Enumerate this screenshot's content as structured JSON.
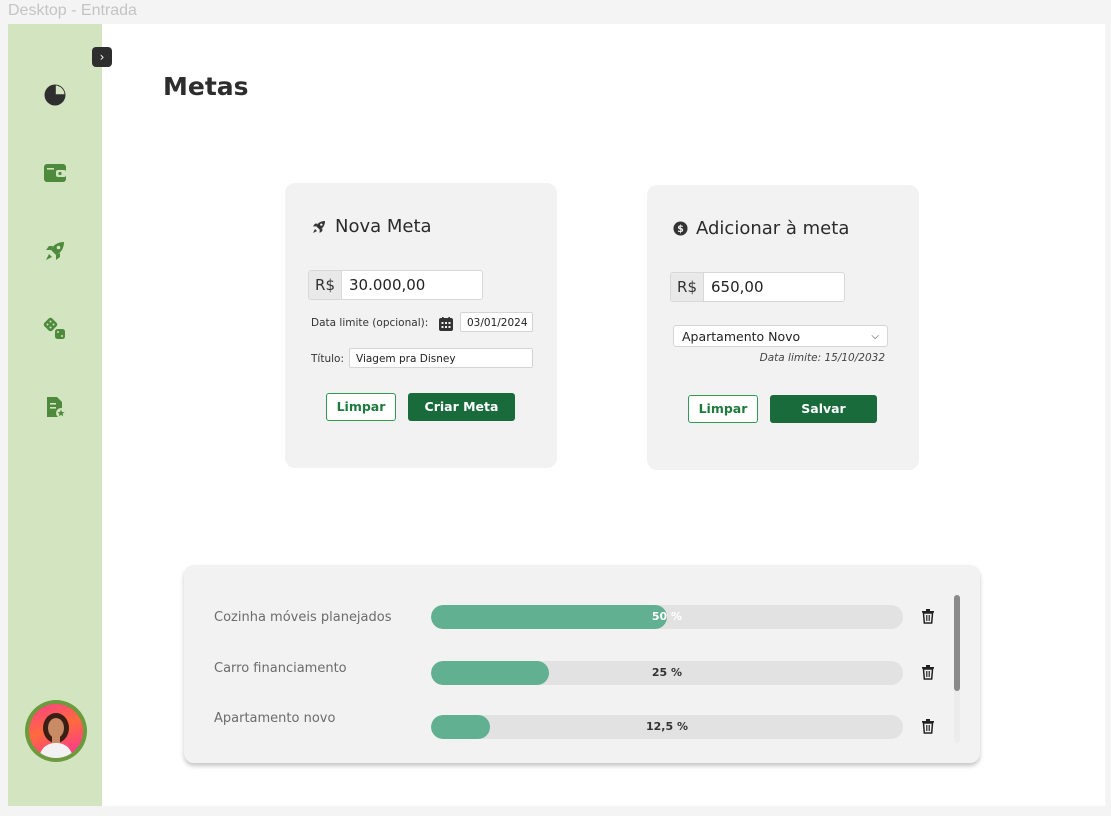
{
  "frame_label": "Desktop - Entrada",
  "page_title": "Metas",
  "colors": {
    "sidebar_bg": "#d3e4c0",
    "primary_button": "#1a6b3c",
    "progress_fill": "#61b091",
    "icon_green": "#4e8a3b"
  },
  "sidebar": {
    "items": [
      {
        "icon": "pie-chart-icon"
      },
      {
        "icon": "wallet-icon"
      },
      {
        "icon": "rocket-icon"
      },
      {
        "icon": "dice-icon"
      },
      {
        "icon": "document-star-icon"
      }
    ]
  },
  "nova_meta": {
    "title": "Nova Meta",
    "currency": "R$",
    "amount": "30.000,00",
    "date_label": "Data limite (opcional):",
    "date_value": "03/01/2024",
    "title_label": "Título:",
    "title_value": "Viagem pra Disney",
    "clear_label": "Limpar",
    "create_label": "Criar Meta"
  },
  "adicionar": {
    "title": "Adicionar à meta",
    "currency": "R$",
    "amount": "650,00",
    "selected_goal": "Apartamento Novo",
    "deadline_note": "Data limite: 15/10/2032",
    "clear_label": "Limpar",
    "save_label": "Salvar"
  },
  "goals": [
    {
      "name": "Cozinha móveis planejados",
      "progress": 0.5,
      "label": "50 %"
    },
    {
      "name": "Carro financiamento",
      "progress": 0.25,
      "label": "25 %"
    },
    {
      "name": "Apartamento novo",
      "progress": 0.125,
      "label": "12,5 %"
    }
  ]
}
